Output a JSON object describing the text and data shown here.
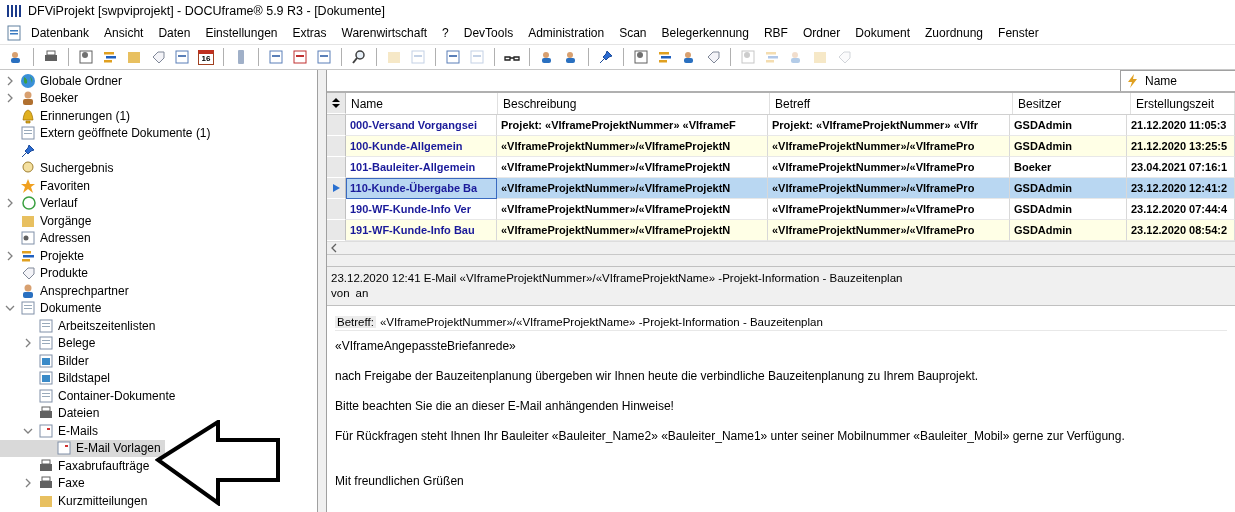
{
  "window": {
    "title": "DFViProjekt [swpviprojekt] - DOCUframe® 5.9 R3 - [Dokumente]"
  },
  "menu": [
    "Datenbank",
    "Ansicht",
    "Daten",
    "Einstellungen",
    "Extras",
    "Warenwirtschaft",
    "?",
    "DevTools",
    "Administration",
    "Scan",
    "Belegerkennung",
    "RBF",
    "Ordner",
    "Dokument",
    "Zuordnung",
    "Fenster"
  ],
  "toolbar": [
    {
      "kind": "button",
      "disabled": false
    },
    {
      "kind": "separator"
    },
    {
      "kind": "button",
      "disabled": false
    },
    {
      "kind": "separator"
    },
    {
      "kind": "button",
      "disabled": false
    },
    {
      "kind": "button",
      "disabled": false
    },
    {
      "kind": "button",
      "disabled": false
    },
    {
      "kind": "button",
      "disabled": false
    },
    {
      "kind": "button",
      "disabled": false
    },
    {
      "kind": "button",
      "disabled": false,
      "text": "16"
    },
    {
      "kind": "separator"
    },
    {
      "kind": "button",
      "disabled": false
    },
    {
      "kind": "separator"
    },
    {
      "kind": "button",
      "disabled": false
    },
    {
      "kind": "button",
      "disabled": false
    },
    {
      "kind": "button",
      "disabled": false
    },
    {
      "kind": "separator"
    },
    {
      "kind": "button",
      "disabled": false
    },
    {
      "kind": "separator"
    },
    {
      "kind": "button",
      "disabled": true
    },
    {
      "kind": "button",
      "disabled": true
    },
    {
      "kind": "separator"
    },
    {
      "kind": "button",
      "disabled": false
    },
    {
      "kind": "button",
      "disabled": true
    },
    {
      "kind": "separator"
    },
    {
      "kind": "button",
      "disabled": false
    },
    {
      "kind": "separator"
    },
    {
      "kind": "button",
      "disabled": false
    },
    {
      "kind": "button",
      "disabled": false
    },
    {
      "kind": "separator"
    },
    {
      "kind": "button",
      "disabled": false
    },
    {
      "kind": "separator"
    },
    {
      "kind": "button",
      "disabled": false
    },
    {
      "kind": "button",
      "disabled": false
    },
    {
      "kind": "button",
      "disabled": false
    },
    {
      "kind": "button",
      "disabled": false
    },
    {
      "kind": "separator"
    },
    {
      "kind": "button",
      "disabled": true
    },
    {
      "kind": "button",
      "disabled": true
    },
    {
      "kind": "button",
      "disabled": true
    },
    {
      "kind": "button",
      "disabled": true
    },
    {
      "kind": "button",
      "disabled": true
    }
  ],
  "tree": [
    {
      "label": "Globale Ordner",
      "expanded": false,
      "selected": false
    },
    {
      "label": "Boeker",
      "expanded": false,
      "selected": false
    },
    {
      "label": "Erinnerungen (1)",
      "selected": false
    },
    {
      "label": "Extern geöffnete Dokumente (1)",
      "selected": false
    },
    {
      "selected": false
    },
    {
      "label": "Suchergebnis",
      "selected": false
    },
    {
      "label": "Favoriten",
      "selected": false
    },
    {
      "label": "Verlauf",
      "expanded": false,
      "selected": false
    },
    {
      "label": "Vorgänge",
      "selected": false
    },
    {
      "label": "Adressen",
      "selected": false
    },
    {
      "label": "Projekte",
      "expanded": false,
      "selected": false
    },
    {
      "label": "Produkte",
      "selected": false
    },
    {
      "label": "Ansprechpartner",
      "selected": false
    },
    {
      "label": "Dokumente",
      "expanded": true,
      "selected": false,
      "children": [
        {
          "label": "Arbeitszeitenlisten",
          "selected": false
        },
        {
          "label": "Belege",
          "expanded": false,
          "selected": false
        },
        {
          "label": "Bilder",
          "selected": false
        },
        {
          "label": "Bildstapel",
          "selected": false
        },
        {
          "label": "Container-Dokumente",
          "selected": false
        },
        {
          "label": "Dateien",
          "selected": false
        },
        {
          "label": "E-Mails",
          "expanded": true,
          "selected": false,
          "children": [
            {
              "label": "E-Mail Vorlagen",
              "selected": true
            }
          ]
        },
        {
          "label": "Faxabrufaufträge",
          "selected": false
        },
        {
          "label": "Faxe",
          "expanded": false,
          "selected": false
        },
        {
          "label": "Kurzmitteilungen",
          "selected": false
        }
      ]
    }
  ],
  "sort_chip": {
    "label": "Name"
  },
  "table": {
    "columns": [
      "Name",
      "Beschreibung",
      "Betreff",
      "Besitzer",
      "Erstellungszeit"
    ],
    "rows": [
      {
        "selected": false,
        "cells": [
          "000-Versand Vorgangsei",
          "Projekt: «VIframeProjektNummer» «VIframeF",
          "Projekt: «VIframeProjektNummer» «VIfr",
          "GSDAdmin",
          "21.12.2020 11:05:3"
        ]
      },
      {
        "selected": false,
        "cells": [
          "100-Kunde-Allgemein",
          "«VIframeProjektNummer»/«VIframeProjektN",
          "«VIframeProjektNummer»/«VIframePro",
          "GSDAdmin",
          "21.12.2020 13:25:5"
        ]
      },
      {
        "selected": false,
        "cells": [
          "101-Bauleiter-Allgemein",
          "«VIframeProjektNummer»/«VIframeProjektN",
          "«VIframeProjektNummer»/«VIframePro",
          "Boeker",
          "23.04.2021 07:16:1"
        ]
      },
      {
        "selected": true,
        "cells": [
          "110-Kunde-Übergabe Ba",
          "«VIframeProjektNummer»/«VIframeProjektN",
          "«VIframeProjektNummer»/«VIframePro",
          "GSDAdmin",
          "23.12.2020 12:41:2"
        ]
      },
      {
        "selected": false,
        "cells": [
          "190-WF-Kunde-Info Ver",
          "«VIframeProjektNummer»/«VIframeProjektN",
          "«VIframeProjektNummer»/«VIframePro",
          "GSDAdmin",
          "23.12.2020 07:44:4"
        ]
      },
      {
        "selected": false,
        "cells": [
          "191-WF-Kunde-Info Bau",
          "«VIframeProjektNummer»/«VIframeProjektN",
          "«VIframeProjektNummer»/«VIframePro",
          "GSDAdmin",
          "23.12.2020 08:54:2"
        ]
      }
    ]
  },
  "preview": {
    "header": "23.12.2020 12:41 E-Mail «VIframeProjektNummer»/«VIframeProjektName» -Projekt-Information - Bauzeitenplan",
    "from_label": "von",
    "to_label": "an",
    "subject_label": "Betreff:",
    "subject": "«VIframeProjektNummer»/«VIframeProjektName» -Projekt-Information - Bauzeitenplan",
    "paragraphs": [
      "«VIframeAngepassteBriefanrede»",
      "nach Freigabe der Bauzeitenplanung übergeben wir Ihnen heute die verbindliche Bauzeitenplanung zu Ihrem Bauprojekt.",
      "Bitte beachten Sie die an dieser E-Mail anhängenden Hinweise!",
      "Für Rückfragen steht Ihnen Ihr Bauleiter «Bauleiter_Name2» «Bauleiter_Name1» unter seiner Mobilnummer «Bauleiter_Mobil» gerne zur Verfügung.",
      "Mit freundlichen Grüßen"
    ]
  }
}
